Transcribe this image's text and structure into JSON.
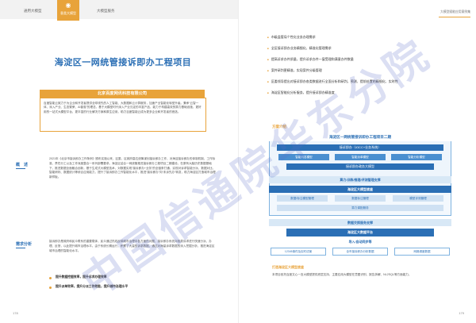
{
  "header": {
    "tabs": [
      "通用大模型",
      "垂类大模型",
      "大模型服务"
    ],
    "active_tab_index": 1,
    "right_title": "大模型赋能应用案例集"
  },
  "left": {
    "title": "海淀区一网统管接诉即办工程项目",
    "company": "北京百度网讯科技有限公司",
    "company_desc": "百度智能云致力于为企业和开发者提供全球领先的人工智能、大数据和云计算服务，加速产业智能化转型升级。秉承“云智一体、深入产业、生态繁荣、AI普惠”的理念，基于大模型时代深入产业沉淀的丰富产品、能力于构建高效的算力基础设施、更好用的一站式大模型平台、更丰富的行业解决方案和原生应用，助力百度智能云成为更多企业和开发者的首选。",
    "section1_label": "概　述",
    "section1_text": "2021年《北京市接诉即办工作条例》颁布实施以来，区委、区政府高位统筹谋划接诉即办工作，对海淀接诉即办的体制机制、工作标准、责任分工以及工作深度整合一系列部署要求。海淀区结合一网统管推进接诉即办工程项目二期建设，在原有大脑历史数据基础下，推进数据全面融合创新，基于生成式大模型技术，对数据实现“接诉即办+业务”的全链条打通，实现对诉求智能分派、数据对比、智能研判、数据统计等综合应用能力，提升了接诉即办工作智能化水平，推进“接诉即办”向“未诉先办”转变，助力海淀区打造城市治理新样板。",
    "section2_label": "需求分析",
    "section2_text": "接诉即办是政府和民众联系的重要载体，民众通过热线反映城市治理中各方面的问题，接诉即办系统对各类诉求进行快速分派、办理、反馈，以此提升城市治理水平。由于系统长期运行，积累了大量的诉求数据，通过对海量诉求数据的深入挖掘分析，推进海淀区城市治理的智能化水平。",
    "bullets": [
      "提升数据挖掘效率，提升诉求办理效率",
      "提升派单效率，提升分派工作效能，提升城市治理水平"
    ],
    "page_number": "178"
  },
  "right": {
    "bullets": [
      "市级监管局个性化业务办理需求",
      "全区接诉即办业务精细化、精准化管理需求",
      "提高诉求办件质量，提升诉求办件一窗受理和满意办件数量",
      "案件研判更精准，实现案件分级管理",
      "区委领导提出对接诉即办各类数据进行全面分析和研判，预测、提前处置的精细化、实时性",
      "海淀区智能化分析服务，提升接诉即办精准度"
    ],
    "section_tag": "方案介绍",
    "diagram": {
      "title": "海淀区一网统管接诉即办工程项目二期",
      "app_label": "接诉即办（IOCC+业务系统）",
      "apps": [
        "智能问答模型",
        "智能派单模型",
        "智能分析模型"
      ],
      "platform_label": "接诉即办政务大模型",
      "mid_label": "算力/训练/推理/评测管理支撑",
      "base_label": "海淀区大模型底座",
      "base_items": [
        "数据/标注模型管理",
        "数据标注管理",
        "模型评测管理"
      ],
      "deploy_label": "算力调配服务",
      "data_support": "数据交换服务支撑",
      "data_platform": "海淀区大数据平台",
      "import_label": "导入/自动同步等",
      "sources": [
        "12345事件及实时试案",
        "全市接诉即办分析数据",
        "网格调度数据"
      ]
    },
    "caption": "打造海淀区大模型底座",
    "caption_text": "本项目依托百度文心一言大模型提供底层支持，主要应用大模型在意图识别、报告拆解、NL2SQL等方面能力。",
    "page_number": "179"
  },
  "watermark": "中国信通院华东分院"
}
